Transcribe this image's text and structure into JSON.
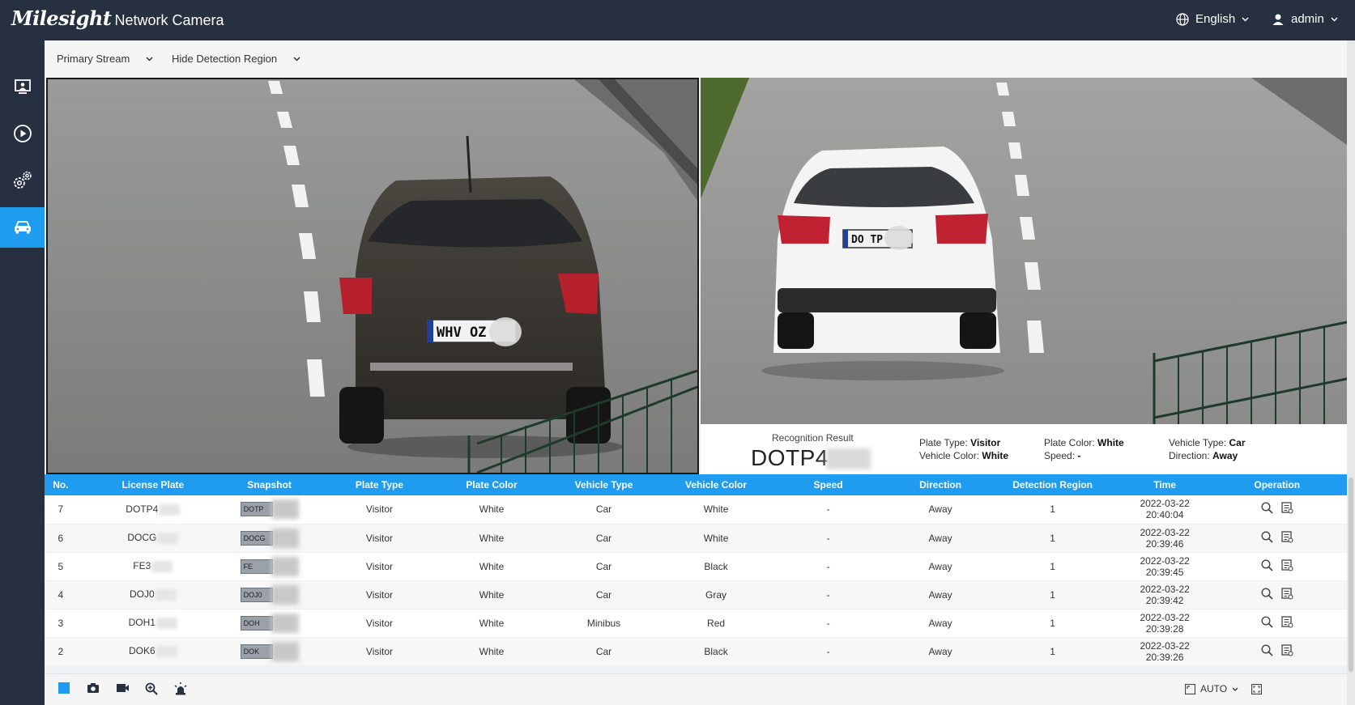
{
  "header": {
    "brand": "Milesight",
    "product": "Network Camera",
    "language": "English",
    "user": "admin"
  },
  "sidebar": {
    "items": [
      {
        "name": "live-view",
        "icon": "monitor-icon",
        "active": false
      },
      {
        "name": "playback",
        "icon": "play-icon",
        "active": false
      },
      {
        "name": "settings",
        "icon": "gear-icon",
        "active": false
      },
      {
        "name": "vehicle",
        "icon": "car-icon",
        "active": true
      }
    ]
  },
  "toolbar": {
    "stream": "Primary Stream",
    "region": "Hide Detection Region"
  },
  "cameras": {
    "left_plate": "WHV OZ",
    "right_plate": "DO TP"
  },
  "recognition": {
    "label": "Recognition Result",
    "plate": "DOTP4",
    "plate_type_label": "Plate Type:",
    "plate_type": "Visitor",
    "plate_color_label": "Plate Color:",
    "plate_color": "White",
    "vehicle_type_label": "Vehicle Type:",
    "vehicle_type": "Car",
    "vehicle_color_label": "Vehicle Color:",
    "vehicle_color": "White",
    "speed_label": "Speed:",
    "speed": "-",
    "direction_label": "Direction:",
    "direction": "Away"
  },
  "table": {
    "headers": [
      "No.",
      "License Plate",
      "Snapshot",
      "Plate Type",
      "Plate Color",
      "Vehicle Type",
      "Vehicle Color",
      "Speed",
      "Direction",
      "Detection Region",
      "Time",
      "Operation"
    ],
    "rows": [
      {
        "no": "7",
        "plate": "DOTP4",
        "snap": "DOTP",
        "plate_type": "Visitor",
        "plate_color": "White",
        "vehicle_type": "Car",
        "vehicle_color": "White",
        "speed": "-",
        "direction": "Away",
        "region": "1",
        "time": "2022-03-22 20:40:04"
      },
      {
        "no": "6",
        "plate": "DOCG",
        "snap": "DOCG",
        "plate_type": "Visitor",
        "plate_color": "White",
        "vehicle_type": "Car",
        "vehicle_color": "White",
        "speed": "-",
        "direction": "Away",
        "region": "1",
        "time": "2022-03-22 20:39:46"
      },
      {
        "no": "5",
        "plate": "FE3",
        "snap": "FE",
        "plate_type": "Visitor",
        "plate_color": "White",
        "vehicle_type": "Car",
        "vehicle_color": "Black",
        "speed": "-",
        "direction": "Away",
        "region": "1",
        "time": "2022-03-22 20:39:45"
      },
      {
        "no": "4",
        "plate": "DOJ0",
        "snap": "DOJ0",
        "plate_type": "Visitor",
        "plate_color": "White",
        "vehicle_type": "Car",
        "vehicle_color": "Gray",
        "speed": "-",
        "direction": "Away",
        "region": "1",
        "time": "2022-03-22 20:39:42"
      },
      {
        "no": "3",
        "plate": "DOH1",
        "snap": "DOH",
        "plate_type": "Visitor",
        "plate_color": "White",
        "vehicle_type": "Minibus",
        "vehicle_color": "Red",
        "speed": "-",
        "direction": "Away",
        "region": "1",
        "time": "2022-03-22 20:39:28"
      },
      {
        "no": "2",
        "plate": "DOK6",
        "snap": "DOK",
        "plate_type": "Visitor",
        "plate_color": "White",
        "vehicle_type": "Car",
        "vehicle_color": "Black",
        "speed": "-",
        "direction": "Away",
        "region": "1",
        "time": "2022-03-22 20:39:26"
      }
    ]
  },
  "bottom": {
    "mode": "AUTO"
  },
  "colors": {
    "accent": "#1f9bf0",
    "header_bg": "#263040"
  }
}
